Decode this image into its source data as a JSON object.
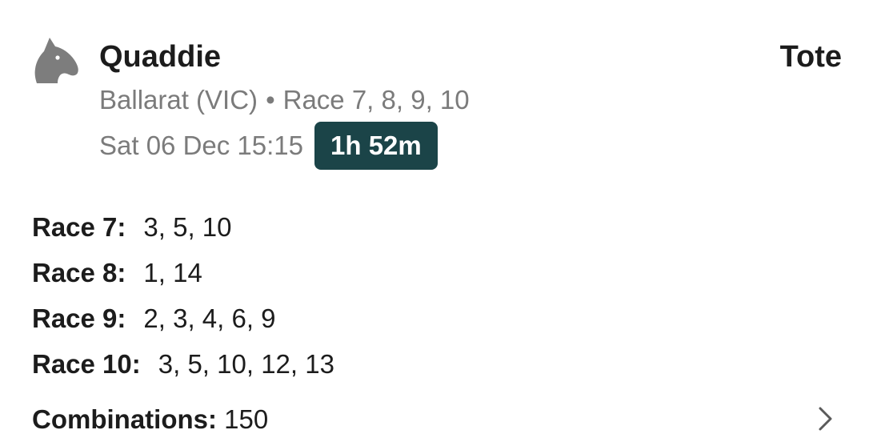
{
  "bet": {
    "icon": "horse-head-icon",
    "title": "Quaddie",
    "kind": "Tote",
    "meeting": "Ballarat (VIC)",
    "separator": "•",
    "races": "Race 7, 8, 9, 10",
    "start_time": "Sat 06 Dec 15:15",
    "countdown": "1h 52m"
  },
  "legs": [
    {
      "label": "Race 7:",
      "runners": "3, 5, 10"
    },
    {
      "label": "Race 8:",
      "runners": "1, 14"
    },
    {
      "label": "Race 9:",
      "runners": "2, 3, 4, 6, 9"
    },
    {
      "label": "Race 10:",
      "runners": "3, 5, 10, 12, 13"
    }
  ],
  "combinations": {
    "label": "Combinations:",
    "value": "150",
    "chevron": "chevron-right-icon"
  },
  "colors": {
    "badge_bg": "#1b4448",
    "muted_text": "#7b7b7b",
    "icon_gray": "#7d7d7d"
  }
}
